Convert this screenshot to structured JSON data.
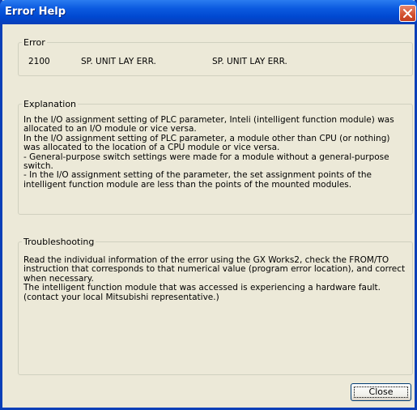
{
  "window": {
    "title": "Error Help"
  },
  "error": {
    "legend": "Error",
    "code": "2100",
    "name": "SP. UNIT LAY ERR.",
    "name_repeat": "SP. UNIT LAY ERR."
  },
  "explanation": {
    "legend": "Explanation",
    "lines": [
      " In the I/O assignment setting of PLC parameter, Inteli (intelligent function module) was",
      "allocated to an I/O module or vice versa.",
      " In the I/O assignment setting of PLC parameter, a module other than CPU (or nothing)",
      "was allocated to the location of a CPU module or vice versa.",
      "- General-purpose switch settings were made for a module without a general-purpose",
      "switch.",
      " - In the I/O assignment setting of the parameter, the set assignment points of the",
      "intelligent function module are less than the points of the mounted modules."
    ]
  },
  "troubleshooting": {
    "legend": "Troubleshooting",
    "lines": [
      " Read the individual information of the error using the GX Works2, check the FROM/TO",
      "instruction that corresponds to that numerical value (program error location), and correct",
      "when necessary.",
      " The intelligent function module that was accessed is experiencing a hardware fault.",
      "(contact your local Mitsubishi representative.)"
    ]
  },
  "buttons": {
    "close_label": "Close"
  },
  "icons": {
    "title_close": "close-icon"
  },
  "colors": {
    "titlebar": "#0a3fb8",
    "close_button": "#d2502f",
    "dialog_bg": "#ece9d8"
  }
}
